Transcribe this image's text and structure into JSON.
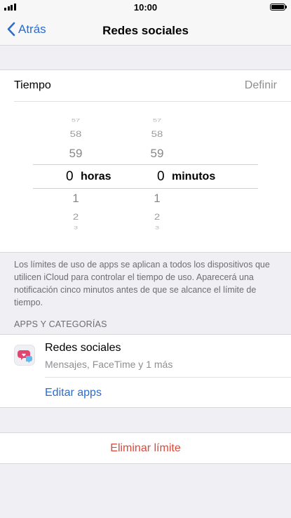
{
  "status_bar": {
    "time": "10:00",
    "signal_icon": "signal-icon",
    "battery_icon": "battery-icon"
  },
  "nav": {
    "back_label": "Atrás",
    "back_icon": "chevron-left-icon",
    "title": "Redes sociales",
    "accent_color": "#2a6ccf"
  },
  "time_row": {
    "label": "Tiempo",
    "value": "Definir"
  },
  "picker": {
    "hours": {
      "above": [
        "57",
        "58",
        "59"
      ],
      "selected": "0",
      "unit": "horas",
      "below": [
        "1",
        "2",
        "3"
      ]
    },
    "minutes": {
      "above": [
        "57",
        "58",
        "59"
      ],
      "selected": "0",
      "unit": "minutos",
      "below": [
        "1",
        "2",
        "3"
      ]
    }
  },
  "info_text": "Los límites de uso de apps se aplican a todos los dispositivos que utilicen iCloud para controlar el tiempo de uso. Aparecerá una notificación cinco minutos antes de que se alcance el límite de tiempo.",
  "apps_section": {
    "header": "APPS Y CATEGORÍAS",
    "category": {
      "name": "Redes sociales",
      "subtitle": "Mensajes, FaceTime y 1 más",
      "icon": "social-chat-icon"
    },
    "edit_label": "Editar apps"
  },
  "delete_label": "Eliminar límite",
  "destructive_color": "#d94a3d"
}
